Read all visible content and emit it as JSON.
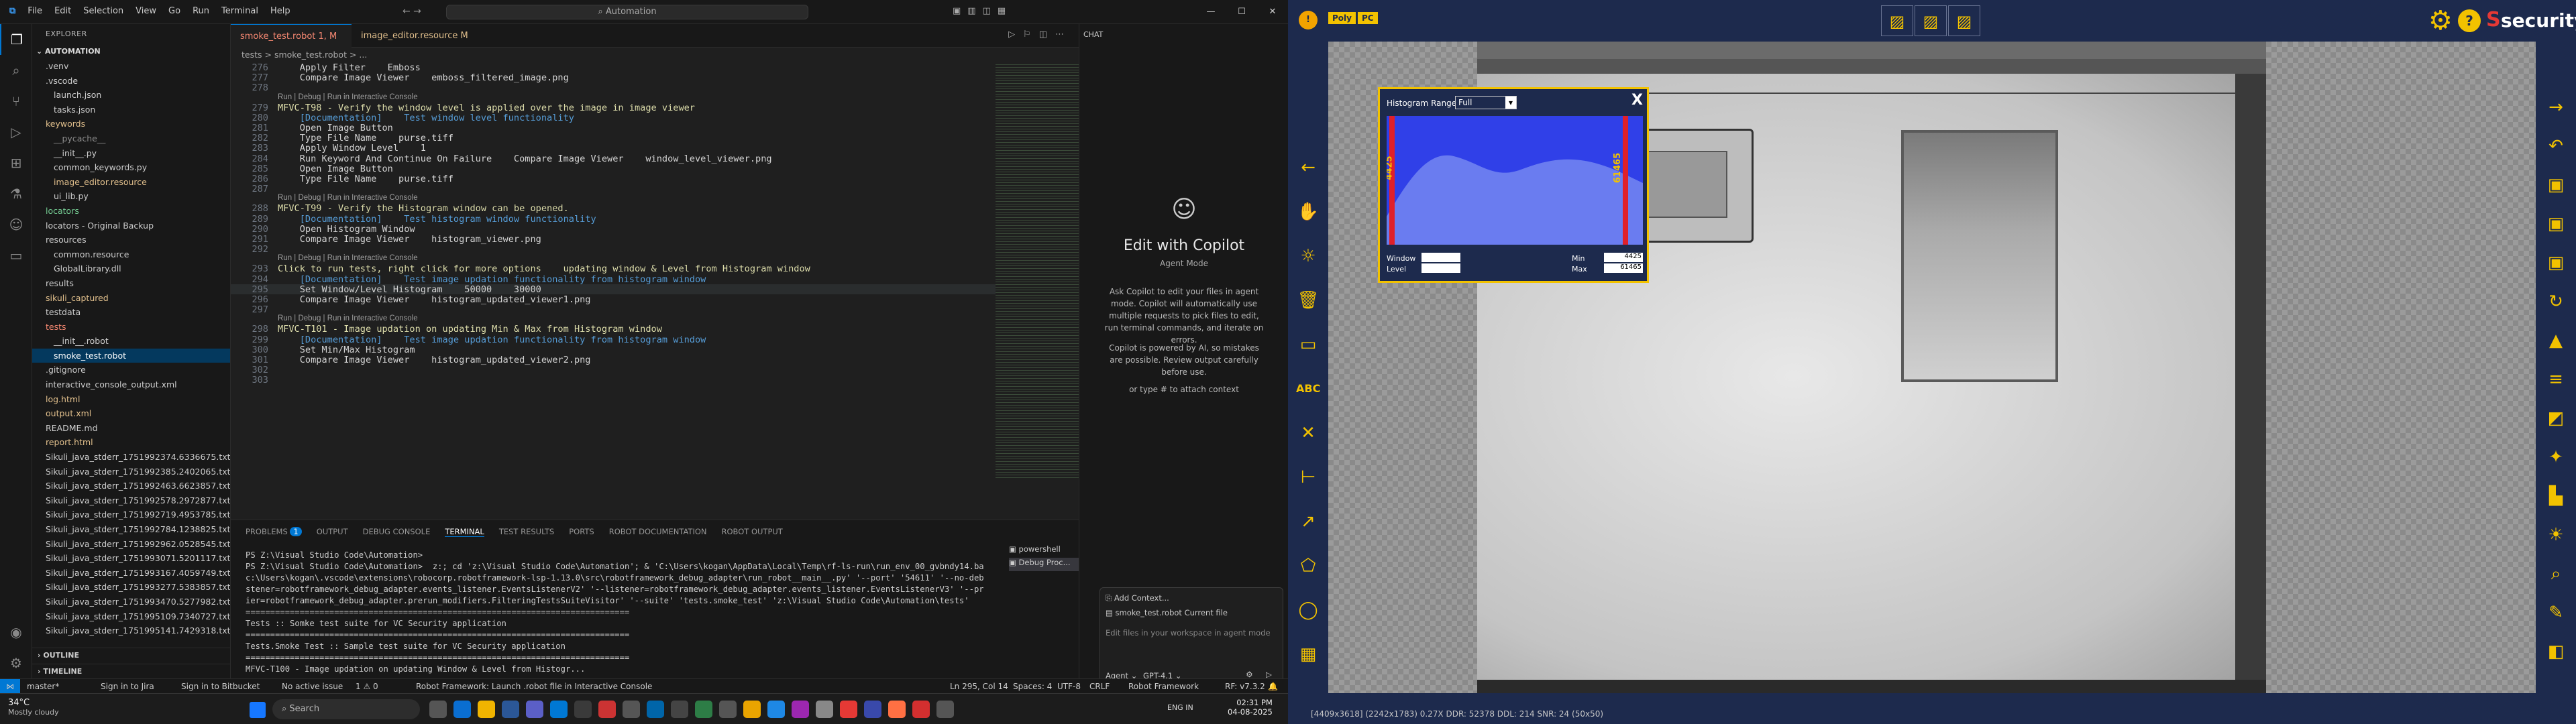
{
  "vscode": {
    "menu": [
      "File",
      "Edit",
      "Selection",
      "View",
      "Go",
      "Run",
      "Terminal",
      "Help"
    ],
    "command_center": "Automation",
    "tabs": [
      {
        "label": "smoke_test.robot 1, M",
        "active": true
      },
      {
        "label": "image_editor.resource M",
        "active": false
      }
    ],
    "breadcrumb": "tests > smoke_test.robot > ...",
    "explorer": {
      "header": "EXPLORER",
      "root": "AUTOMATION",
      "items": [
        {
          "label": ".venv",
          "indent": 1,
          "cls": ""
        },
        {
          "label": ".vscode",
          "indent": 1,
          "cls": ""
        },
        {
          "label": "launch.json",
          "indent": 2,
          "cls": ""
        },
        {
          "label": "tasks.json",
          "indent": 2,
          "cls": ""
        },
        {
          "label": "keywords",
          "indent": 1,
          "cls": "mod"
        },
        {
          "label": "__pycache__",
          "indent": 2,
          "cls": "gry"
        },
        {
          "label": "__init__.py",
          "indent": 2,
          "cls": ""
        },
        {
          "label": "common_keywords.py",
          "indent": 2,
          "cls": ""
        },
        {
          "label": "image_editor.resource",
          "indent": 2,
          "cls": "mod"
        },
        {
          "label": "ui_lib.py",
          "indent": 2,
          "cls": ""
        },
        {
          "label": "locators",
          "indent": 1,
          "cls": "grn"
        },
        {
          "label": "locators - Original Backup",
          "indent": 1,
          "cls": ""
        },
        {
          "label": "resources",
          "indent": 1,
          "cls": ""
        },
        {
          "label": "common.resource",
          "indent": 2,
          "cls": ""
        },
        {
          "label": "GlobalLibrary.dll",
          "indent": 2,
          "cls": ""
        },
        {
          "label": "results",
          "indent": 1,
          "cls": ""
        },
        {
          "label": "sikuli_captured",
          "indent": 1,
          "cls": "mod"
        },
        {
          "label": "testdata",
          "indent": 1,
          "cls": ""
        },
        {
          "label": "tests",
          "indent": 1,
          "cls": "red"
        },
        {
          "label": "__init__.robot",
          "indent": 2,
          "cls": ""
        },
        {
          "label": "smoke_test.robot",
          "indent": 2,
          "cls": "sel"
        },
        {
          "label": ".gitignore",
          "indent": 1,
          "cls": ""
        },
        {
          "label": "interactive_console_output.xml",
          "indent": 1,
          "cls": ""
        },
        {
          "label": "log.html",
          "indent": 1,
          "cls": "mod"
        },
        {
          "label": "output.xml",
          "indent": 1,
          "cls": "mod"
        },
        {
          "label": "README.md",
          "indent": 1,
          "cls": ""
        },
        {
          "label": "report.html",
          "indent": 1,
          "cls": "mod"
        },
        {
          "label": "Sikuli_java_stderr_1751992374.6336675.txt",
          "indent": 1,
          "cls": ""
        },
        {
          "label": "Sikuli_java_stderr_1751992385.2402065.txt",
          "indent": 1,
          "cls": ""
        },
        {
          "label": "Sikuli_java_stderr_1751992463.6623857.txt",
          "indent": 1,
          "cls": ""
        },
        {
          "label": "Sikuli_java_stderr_1751992578.2972877.txt",
          "indent": 1,
          "cls": ""
        },
        {
          "label": "Sikuli_java_stderr_1751992719.4953785.txt",
          "indent": 1,
          "cls": ""
        },
        {
          "label": "Sikuli_java_stderr_1751992784.1238825.txt",
          "indent": 1,
          "cls": ""
        },
        {
          "label": "Sikuli_java_stderr_1751992962.0528545.txt",
          "indent": 1,
          "cls": ""
        },
        {
          "label": "Sikuli_java_stderr_1751993071.5201117.txt",
          "indent": 1,
          "cls": ""
        },
        {
          "label": "Sikuli_java_stderr_1751993167.4059749.txt",
          "indent": 1,
          "cls": ""
        },
        {
          "label": "Sikuli_java_stderr_1751993277.5383857.txt",
          "indent": 1,
          "cls": ""
        },
        {
          "label": "Sikuli_java_stderr_1751993470.5277982.txt",
          "indent": 1,
          "cls": ""
        },
        {
          "label": "Sikuli_java_stderr_1751995109.7340727.txt",
          "indent": 1,
          "cls": ""
        },
        {
          "label": "Sikuli_java_stderr_1751995141.7429318.txt",
          "indent": 1,
          "cls": ""
        }
      ],
      "outline": "OUTLINE",
      "timeline": "TIMELINE"
    },
    "code_lines": [
      {
        "n": "276",
        "t": "    Apply Filter    Emboss",
        "type": "code"
      },
      {
        "n": "277",
        "t": "    Compare Image Viewer    emboss_filtered_image.png",
        "type": "code"
      },
      {
        "n": "278",
        "t": "",
        "type": "code"
      },
      {
        "n": "",
        "t": "Run | Debug | Run in Interactive Console",
        "type": "lens"
      },
      {
        "n": "279",
        "t": "MFVC-T98 - Verify the window level is applied over the image in image viewer",
        "type": "tc"
      },
      {
        "n": "280",
        "t": "    [Documentation]    Test window level functionality",
        "type": "doc"
      },
      {
        "n": "281",
        "t": "    Open Image Button",
        "type": "code"
      },
      {
        "n": "282",
        "t": "    Type File Name    purse.tiff",
        "type": "code"
      },
      {
        "n": "283",
        "t": "    Apply Window Level    1",
        "type": "code"
      },
      {
        "n": "284",
        "t": "    Run Keyword And Continue On Failure    Compare Image Viewer    window_level_viewer.png",
        "type": "code"
      },
      {
        "n": "285",
        "t": "    Open Image Button",
        "type": "code"
      },
      {
        "n": "286",
        "t": "    Type File Name    purse.tiff",
        "type": "code"
      },
      {
        "n": "287",
        "t": "",
        "type": "code"
      },
      {
        "n": "",
        "t": "Run | Debug | Run in Interactive Console",
        "type": "lens"
      },
      {
        "n": "288",
        "t": "MFVC-T99 - Verify the Histogram window can be opened.",
        "type": "tc"
      },
      {
        "n": "289",
        "t": "    [Documentation]    Test histogram window functionality",
        "type": "doc"
      },
      {
        "n": "290",
        "t": "    Open Histogram Window",
        "type": "code"
      },
      {
        "n": "291",
        "t": "    Compare Image Viewer    histogram_viewer.png",
        "type": "code"
      },
      {
        "n": "292",
        "t": "",
        "type": "code"
      },
      {
        "n": "",
        "t": "Run | Debug | Run in Interactive Console",
        "type": "lens"
      },
      {
        "n": "293",
        "t": "Click to run tests, right click for more options    updating window & Level from Histogram window",
        "type": "tc"
      },
      {
        "n": "294",
        "t": "    [Documentation]    Test image updation functionality from histogram window",
        "type": "doc"
      },
      {
        "n": "295",
        "t": "    Set Window/Level Histogram    50000    30000",
        "type": "code"
      },
      {
        "n": "296",
        "t": "    Compare Image Viewer    histogram_updated_viewer1.png",
        "type": "code"
      },
      {
        "n": "297",
        "t": "",
        "type": "code"
      },
      {
        "n": "",
        "t": "Run | Debug | Run in Interactive Console",
        "type": "lens"
      },
      {
        "n": "298",
        "t": "MFVC-T101 - Image updation on updating Min & Max from Histogram window",
        "type": "tc"
      },
      {
        "n": "299",
        "t": "    [Documentation]    Test image updation functionality from histogram window",
        "type": "doc"
      },
      {
        "n": "300",
        "t": "    Set Min/Max Histogram",
        "type": "code"
      },
      {
        "n": "301",
        "t": "    Compare Image Viewer    histogram_updated_viewer2.png",
        "type": "code"
      },
      {
        "n": "302",
        "t": "",
        "type": "code"
      },
      {
        "n": "303",
        "t": "",
        "type": "code"
      }
    ],
    "panel_tabs": [
      "PROBLEMS",
      "OUTPUT",
      "DEBUG CONSOLE",
      "TERMINAL",
      "TEST RESULTS",
      "PORTS",
      "ROBOT DOCUMENTATION",
      "ROBOT OUTPUT"
    ],
    "problems_badge": "1",
    "terminal_lines": [
      "PS Z:\\Visual Studio Code\\Automation>",
      "PS Z:\\Visual Studio Code\\Automation>  z:; cd 'z:\\Visual Studio Code\\Automation'; & 'C:\\Users\\kogan\\AppData\\Local\\Temp\\rf-ls-run\\run_env_00_gvbndy14.bat' '-u' 'c:",
      "c:\\Users\\kogan\\.vscode\\extensions\\robocorp.robotframework-lsp-1.13.0\\src\\robotframework_debug_adapter\\run_robot__main__.py' '--port' '54611' '--no-debug' '--li",
      "stener=robotframework_debug_adapter.events_listener.EventsListenerV2' '--listener=robotframework_debug_adapter.events_listener.EventsListenerV3' '--prerunmodif",
      "ier=robotframework_debug_adapter.prerun_modifiers.FilteringTestsSuiteVisitor' '--suite' 'tests.smoke_test' 'z:\\Visual Studio Code\\Automation\\tests'",
      "==============================================================================",
      "Tests :: Somke test suite for VC Security application",
      "==============================================================================",
      "Tests.Smoke Test :: Sample test suite for VC Security application",
      "==============================================================================",
      "MFVC-T100 - Image updation on updating Window & Level from Histogr..."
    ],
    "terminal_sessions": [
      "powershell",
      "Debug Proc..."
    ],
    "copilot": {
      "header": "CHAT",
      "title": "Edit with Copilot",
      "mode": "Agent Mode",
      "desc": "Ask Copilot to edit your files in agent mode. Copilot will automatically use multiple requests to pick files to edit, run terminal commands, and iterate on errors.",
      "note": "Copilot is powered by AI, so mistakes are possible. Review output carefully before use.",
      "attach": "or type # to attach context",
      "add_context": "Add Context...",
      "current_file": "smoke_test.robot  Current file",
      "input_placeholder": "Edit files in your workspace in agent mode",
      "agent": "Agent",
      "model": "GPT-4.1"
    },
    "status": {
      "branch": "master*",
      "jira": "Sign in to Jira",
      "bitbucket": "Sign in to Bitbucket",
      "issue": "No active issue",
      "problems": "1 ⚠ 0",
      "robot": "Robot Framework: Launch .robot file in Interactive Console",
      "pos": "Ln 295, Col 14",
      "spaces": "Spaces: 4",
      "enc": "UTF-8",
      "eol": "CRLF",
      "lang": "Robot Framework",
      "rf": "RF: v7.3.2"
    },
    "taskbar": {
      "weather_temp": "34°C",
      "weather_desc": "Mostly cloudy",
      "search": "Search",
      "time": "02:31 PM",
      "date": "04-08-2025",
      "lang": "ENG IN"
    }
  },
  "app": {
    "top_labels": [
      "Poly",
      "PC"
    ],
    "brand": "security",
    "histogram": {
      "range_label": "Histogram Range:",
      "range_value": "Full",
      "close": "X",
      "min_marker": "4425",
      "max_marker": "61465",
      "window_label": "Window",
      "level_label": "Level",
      "min_label": "Min",
      "max_label": "Max",
      "min_value": "4425",
      "max_value": "61465"
    },
    "status_text": "[4409x3618] (2242x1783) 0.27X DDR: 52378 DDL: 214 SNR: 24 (50x50)",
    "left_tools": [
      "arrow-left-icon",
      "hand-icon",
      "brightness-icon",
      "trash-icon",
      "rect-icon",
      "abc-text-icon",
      "cross-measure-icon",
      "ruler-icon",
      "arrow-diag-icon",
      "pentagon-icon",
      "ellipse-icon",
      "grid-icon"
    ],
    "right_tools": [
      "arrow-right-icon",
      "undo-icon",
      "save-icon",
      "save-as-icon",
      "save-all-icon",
      "refresh-icon",
      "image-filter-icon",
      "sliders-icon",
      "roi-icon",
      "magic-icon",
      "histogram-icon",
      "brightness-plus-icon",
      "zoom-icon",
      "pen-icon",
      "contrast-icon"
    ]
  },
  "colors": {
    "accent": "#0078d4",
    "app_bg": "#1d2a4d",
    "app_icon": "#f2c200",
    "histogram_fill": "#2a36e0"
  }
}
